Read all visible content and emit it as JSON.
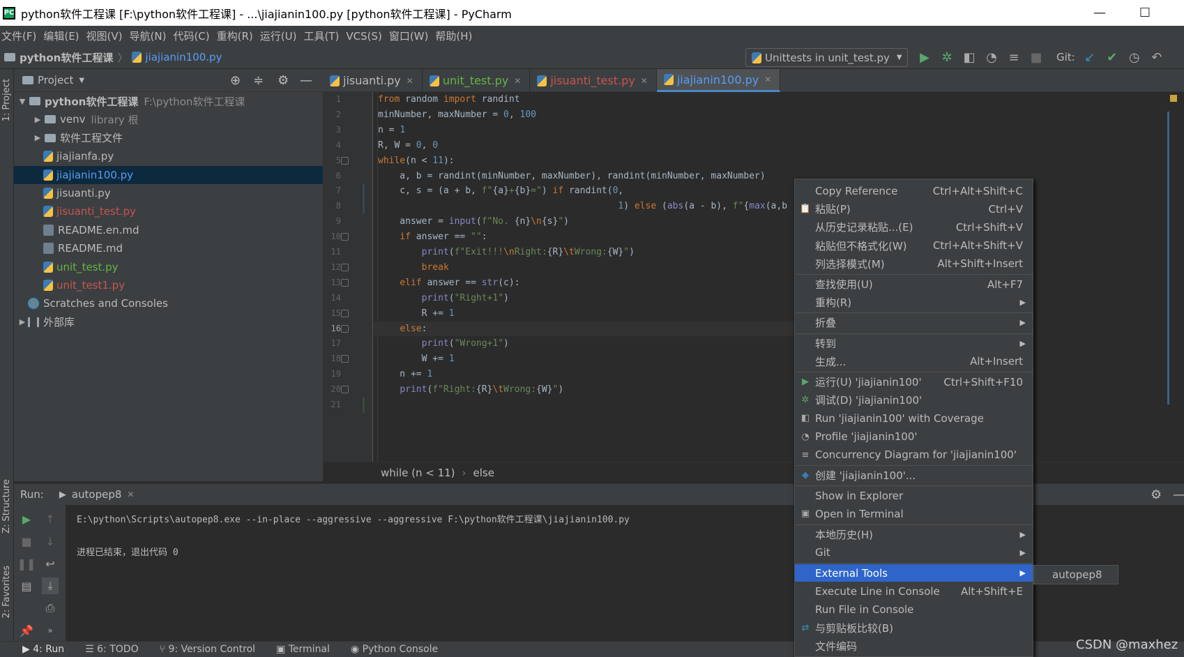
{
  "window": {
    "title": "python软件工程课 [F:\\python软件工程课] - ...\\jiajianin100.py [python软件工程课] - PyCharm",
    "min": "—",
    "max": "☐",
    "close": "✕"
  },
  "menu": [
    "文件(F)",
    "编辑(E)",
    "视图(V)",
    "导航(N)",
    "代码(C)",
    "重构(R)",
    "运行(U)",
    "工具(T)",
    "VCS(S)",
    "窗口(W)",
    "帮助(H)"
  ],
  "nav": {
    "project": "python软件工程课",
    "file": "jiajianin100.py"
  },
  "toolbar": {
    "run_config": "Unittests in unit_test.py",
    "git_label": "Git:"
  },
  "left_strip": {
    "project": "1: Project",
    "structure": "Z: Structure",
    "favorites": "2: Favorites"
  },
  "project_panel": {
    "title": "Project",
    "tree": [
      {
        "label": "python软件工程课",
        "extra": "F:\\python软件工程课",
        "color": "#bbbbbb",
        "level": 0,
        "icon": "folder",
        "expand": "▼"
      },
      {
        "label": "venv",
        "extra": "library 根",
        "color": "#bbbbbb",
        "level": 1,
        "icon": "folder",
        "expand": "▶"
      },
      {
        "label": "软件工程文件",
        "extra": "",
        "color": "#bbbbbb",
        "level": 1,
        "icon": "folder",
        "expand": "▶"
      },
      {
        "label": "jiajianfa.py",
        "extra": "",
        "color": "#bbbbbb",
        "level": 1,
        "icon": "py",
        "expand": ""
      },
      {
        "label": "jiajianin100.py",
        "extra": "",
        "color": "#589df6",
        "level": 1,
        "icon": "py",
        "expand": "",
        "selected": true
      },
      {
        "label": "jisuanti.py",
        "extra": "",
        "color": "#bbbbbb",
        "level": 1,
        "icon": "py",
        "expand": ""
      },
      {
        "label": "jisuanti_test.py",
        "extra": "",
        "color": "#c75450",
        "level": 1,
        "icon": "py",
        "expand": ""
      },
      {
        "label": "README.en.md",
        "extra": "",
        "color": "#bbbbbb",
        "level": 1,
        "icon": "md",
        "expand": ""
      },
      {
        "label": "README.md",
        "extra": "",
        "color": "#bbbbbb",
        "level": 1,
        "icon": "md",
        "expand": ""
      },
      {
        "label": "unit_test.py",
        "extra": "",
        "color": "#62b543",
        "level": 1,
        "icon": "py",
        "expand": ""
      },
      {
        "label": "unit_test1.py",
        "extra": "",
        "color": "#c75450",
        "level": 1,
        "icon": "py",
        "expand": ""
      },
      {
        "label": "Scratches and Consoles",
        "extra": "",
        "color": "#bbbbbb",
        "level": 0,
        "icon": "scratch",
        "expand": ""
      },
      {
        "label": "外部库",
        "extra": "",
        "color": "#bbbbbb",
        "level": 0,
        "icon": "lib",
        "expand": "▶"
      }
    ]
  },
  "tabs": [
    {
      "label": "jisuanti.py",
      "color": "#bbbbbb"
    },
    {
      "label": "unit_test.py",
      "color": "#62b543"
    },
    {
      "label": "jisuanti_test.py",
      "color": "#c75450"
    },
    {
      "label": "jiajianin100.py",
      "color": "#589df6",
      "active": true
    }
  ],
  "code_lines": [
    "<span class=\"kw\">from</span> random <span class=\"kw\">import</span> randint",
    "minNumber, maxNumber = <span class=\"num\">0</span>, <span class=\"num\">100</span>",
    "n = <span class=\"num\">1</span>",
    "R, W = <span class=\"num\">0</span>, <span class=\"num\">0</span>",
    "<span class=\"kw\">while</span>(n &lt; <span class=\"num\">11</span>):",
    "    a, b = randint(minNumber, maxNumber), randint(minNumber, maxNumber)",
    "    c, s = (a + b, <span class=\"str\">f\"</span>{a}<span class=\"str\">+</span>{b}<span class=\"str\">=\"</span>) <span class=\"kw\">if</span> randint(<span class=\"num\">0</span>,",
    "                                            <span class=\"num\">1</span>) <span class=\"kw\">else</span> (<span class=\"bi\">abs</span>(a - b), <span class=\"str\">f\"</span>{<span class=\"bi\">max</span>(a,b",
    "    answer = <span class=\"bi\">input</span>(<span class=\"str\">f\"No. </span>{n}<span class=\"kw\">\\n</span>{s}<span class=\"str\">\"</span>)",
    "    <span class=\"kw\">if</span> answer == <span class=\"str\">\"\"</span>:",
    "        <span class=\"bi\">print</span>(<span class=\"str\">f\"Exit!!!</span><span class=\"kw\">\\n</span><span class=\"str\">Right:</span>{R}<span class=\"kw\">\\t</span><span class=\"str\">Wrong:</span>{W}<span class=\"str\">\"</span>)",
    "        <span class=\"kw\">break</span>",
    "    <span class=\"kw\">elif</span> answer == <span class=\"bi\">str</span>(c):",
    "        <span class=\"bi\">print</span>(<span class=\"str\">\"Right+1\"</span>)",
    "        R += <span class=\"num\">1</span>",
    "    <span class=\"kw\">else</span>:",
    "        <span class=\"bi\">print</span>(<span class=\"str\">\"Wrong+1\"</span>)",
    "        W += <span class=\"num\">1</span>",
    "    n += <span class=\"num\">1</span>",
    "    <span class=\"bi\">print</span>(<span class=\"str\">f\"Right:</span>{R}<span class=\"kw\">\\t</span><span class=\"str\">Wrong:</span>{W}<span class=\"str\">\"</span>)",
    ""
  ],
  "line_numbers": [
    "1",
    "2",
    "3",
    "4",
    "5",
    "6",
    "7",
    "8",
    "9",
    "10",
    "11",
    "12",
    "13",
    "14",
    "15",
    "16",
    "17",
    "18",
    "19",
    "20",
    "21"
  ],
  "current_line": 16,
  "breadcrumb": {
    "part1": "while (n < 11)",
    "sep": "›",
    "part2": "else"
  },
  "run_panel": {
    "label": "Run:",
    "tab": "autopep8",
    "console_cmd": "E:\\python\\Scripts\\autopep8.exe --in-place --aggressive --aggressive F:\\python软件工程课\\jiajianin100.py",
    "console_exit": "进程已结束，退出代码 0"
  },
  "bottom_bar": [
    {
      "label": "4: Run",
      "icon": "▶"
    },
    {
      "label": "6: TODO",
      "icon": "☰"
    },
    {
      "label": "9: Version Control",
      "icon": "⑂"
    },
    {
      "label": "Terminal",
      "icon": "▣"
    },
    {
      "label": "Python Console",
      "icon": "◉"
    }
  ],
  "context_menu": [
    {
      "label": "Copy Reference",
      "shortcut": "Ctrl+Alt+Shift+C",
      "icon": ""
    },
    {
      "label": "粘贴(P)",
      "shortcut": "Ctrl+V",
      "icon": "clipboard-icon"
    },
    {
      "label": "从历史记录粘贴...(E)",
      "shortcut": "Ctrl+Shift+V",
      "icon": ""
    },
    {
      "label": "粘贴但不格式化(W)",
      "shortcut": "Ctrl+Alt+Shift+V",
      "icon": ""
    },
    {
      "label": "列选择模式(M)",
      "shortcut": "Alt+Shift+Insert",
      "icon": "",
      "sep_after": true
    },
    {
      "label": "查找使用(U)",
      "shortcut": "Alt+F7",
      "icon": ""
    },
    {
      "label": "重构(R)",
      "shortcut": "",
      "icon": "",
      "submenu": true,
      "sep_after": true
    },
    {
      "label": "折叠",
      "shortcut": "",
      "icon": "",
      "submenu": true,
      "sep_after": true
    },
    {
      "label": "转到",
      "shortcut": "",
      "icon": "",
      "submenu": true
    },
    {
      "label": "生成...",
      "shortcut": "Alt+Insert",
      "icon": "",
      "sep_after": true
    },
    {
      "label": "运行(U) 'jiajianin100'",
      "shortcut": "Ctrl+Shift+F10",
      "icon": "run-icon"
    },
    {
      "label": "调试(D) 'jiajianin100'",
      "shortcut": "",
      "icon": "debug-icon"
    },
    {
      "label": "Run 'jiajianin100' with Coverage",
      "shortcut": "",
      "icon": "coverage-icon"
    },
    {
      "label": "Profile 'jiajianin100'",
      "shortcut": "",
      "icon": "profile-icon"
    },
    {
      "label": "Concurrency Diagram for 'jiajianin100'",
      "shortcut": "",
      "icon": "concurrency-icon",
      "sep_after": true
    },
    {
      "label": "创建 'jiajianin100'...",
      "shortcut": "",
      "icon": "python-icon",
      "sep_after": true
    },
    {
      "label": "Show in Explorer",
      "shortcut": "",
      "icon": ""
    },
    {
      "label": "Open in Terminal",
      "shortcut": "",
      "icon": "terminal-icon",
      "sep_after": true
    },
    {
      "label": "本地历史(H)",
      "shortcut": "",
      "icon": "",
      "submenu": true
    },
    {
      "label": "Git",
      "shortcut": "",
      "icon": "",
      "submenu": true,
      "sep_after": true
    },
    {
      "label": "External Tools",
      "shortcut": "",
      "icon": "",
      "submenu": true,
      "highlighted": true
    },
    {
      "label": "Execute Line in Console",
      "shortcut": "Alt+Shift+E",
      "icon": ""
    },
    {
      "label": "Run File in Console",
      "shortcut": "",
      "icon": ""
    },
    {
      "label": "与剪贴板比较(B)",
      "shortcut": "",
      "icon": "compare-icon"
    },
    {
      "label": "文件编码",
      "shortcut": "",
      "icon": ""
    }
  ],
  "submenu_item": "autopep8",
  "watermark": "CSDN @maxhez"
}
